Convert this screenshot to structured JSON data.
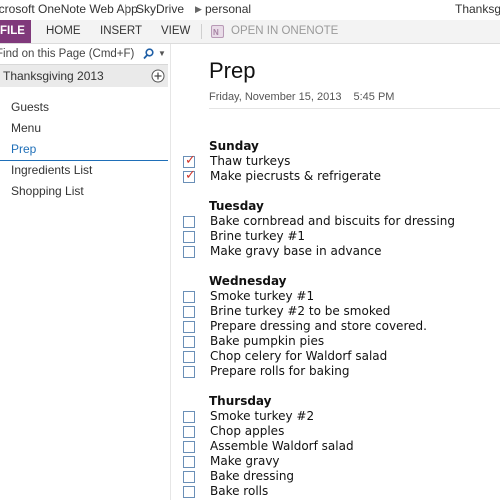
{
  "titlebar": {
    "app_name": "icrosoft OneNote Web App",
    "separator": "|",
    "breadcrumb_root": "SkyDrive",
    "breadcrumb_folder": "personal",
    "document_name": "Thanksgi"
  },
  "ribbon": {
    "file_label": "FILE",
    "tabs": [
      "HOME",
      "INSERT",
      "VIEW"
    ],
    "open_in_onenote_label": "OPEN IN ONENOTE",
    "accent_color": "#80397b"
  },
  "sidebar": {
    "search_placeholder": "Find on this Page (Cmd+F)",
    "section_name": "Thanksgiving 2013",
    "pages": [
      {
        "label": "Guests"
      },
      {
        "label": "Menu"
      },
      {
        "label": "Prep",
        "selected": true
      },
      {
        "label": "Ingredients List"
      },
      {
        "label": "Shopping List"
      }
    ]
  },
  "page": {
    "title": "Prep",
    "date": "Friday, November 15, 2013",
    "time": "5:45 PM",
    "days": [
      {
        "name": "Sunday",
        "tasks": [
          {
            "text": "Thaw turkeys",
            "checked": true
          },
          {
            "text": "Make piecrusts & refrigerate",
            "checked": true
          }
        ]
      },
      {
        "name": "Tuesday",
        "tasks": [
          {
            "text": "Bake cornbread and biscuits for dressing",
            "checked": false
          },
          {
            "text": "Brine turkey #1",
            "checked": false
          },
          {
            "text": "Make gravy base in advance",
            "checked": false
          }
        ]
      },
      {
        "name": "Wednesday",
        "tasks": [
          {
            "text": "Smoke turkey #1",
            "checked": false
          },
          {
            "text": "Brine turkey #2 to be smoked",
            "checked": false
          },
          {
            "text": "Prepare dressing and store covered.",
            "checked": false
          },
          {
            "text": "Bake pumpkin pies",
            "checked": false
          },
          {
            "text": "Chop celery for Waldorf salad",
            "checked": false
          },
          {
            "text": "Prepare rolls for baking",
            "checked": false
          }
        ]
      },
      {
        "name": "Thursday",
        "tasks": [
          {
            "text": "Smoke turkey #2",
            "checked": false
          },
          {
            "text": "Chop apples",
            "checked": false
          },
          {
            "text": "Assemble Waldorf salad",
            "checked": false
          },
          {
            "text": "Make gravy",
            "checked": false
          },
          {
            "text": "Bake dressing",
            "checked": false
          },
          {
            "text": "Bake rolls",
            "checked": false
          }
        ]
      }
    ]
  }
}
